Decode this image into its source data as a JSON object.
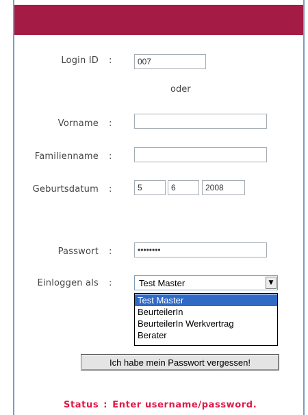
{
  "colors": {
    "header": "#a41c45",
    "status": "#e0194a",
    "frame": "#7a9cc4",
    "selected_option": "#316ac5"
  },
  "form": {
    "login_id": {
      "label": "Login ID",
      "value": "007"
    },
    "separator": "oder",
    "vorname": {
      "label": "Vorname",
      "value": ""
    },
    "familienname": {
      "label": "Familienname",
      "value": ""
    },
    "geburtsdatum": {
      "label": "Geburtsdatum",
      "day": "5",
      "month": "6",
      "year": "2008"
    },
    "passwort": {
      "label": "Passwort",
      "value": "12345678"
    },
    "einloggen_als": {
      "label": "Einloggen als",
      "selected": "Test Master",
      "options": [
        "Test Master",
        "BeurteilerIn",
        "BeurteilerIn Werkvertrag",
        "Berater"
      ]
    },
    "colon": ":",
    "forgot_button": "Ich habe mein Passwort vergessen!"
  },
  "status": {
    "label": "Status",
    "message": "Enter username/password."
  },
  "icons": {
    "dropdown_arrow": "chevron-down-icon"
  }
}
